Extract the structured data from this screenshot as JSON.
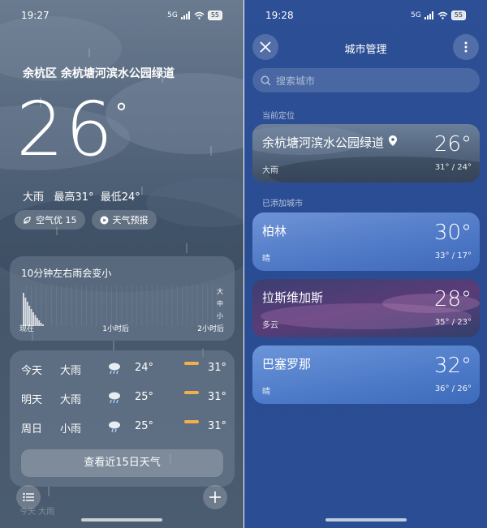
{
  "left": {
    "status": {
      "time": "19:27",
      "battery": "55",
      "network": "5G"
    },
    "location": "余杭区 余杭塘河滨水公园绿道",
    "temperature": "26",
    "degree": "°",
    "description": "大雨",
    "high": "最高31°",
    "low": "最低24°",
    "chips": [
      {
        "label": "空气优 15",
        "icon": "leaf-icon"
      },
      {
        "label": "天气预报",
        "icon": "play-icon"
      }
    ],
    "precip": {
      "title": "10分钟左右雨会变小",
      "x_labels": [
        "现在",
        "1小时后",
        "2小时后"
      ],
      "side_labels": [
        "大",
        "中",
        "小"
      ],
      "intensity": [
        0.82,
        0.7,
        0.6,
        0.5,
        0.42,
        0.34,
        0.27,
        0.2,
        0.14,
        0.08,
        0.04
      ]
    },
    "daily": [
      {
        "day": "今天",
        "cond": "大雨",
        "low": "24°",
        "high": "31°"
      },
      {
        "day": "明天",
        "cond": "大雨",
        "low": "25°",
        "high": "31°"
      },
      {
        "day": "周日",
        "cond": "小雨",
        "low": "25°",
        "high": "31°"
      }
    ],
    "fifteen_button": "查看近15日天气",
    "ghost_text": "今天 大雨"
  },
  "right": {
    "status": {
      "time": "19:28",
      "battery": "55",
      "network": "5G"
    },
    "title": "城市管理",
    "search_placeholder": "搜索城市",
    "current_section": "当前定位",
    "added_section": "已添加城市",
    "current": {
      "name": "余杭塘河滨水公园绿道",
      "cond": "大雨",
      "temp": "26°",
      "range": "31° / 24°"
    },
    "cities": [
      {
        "name": "柏林",
        "cond": "晴",
        "temp": "30°",
        "range": "33° / 17°"
      },
      {
        "name": "拉斯维加斯",
        "cond": "多云",
        "temp": "28°",
        "range": "35° / 23°"
      },
      {
        "name": "巴塞罗那",
        "cond": "晴",
        "temp": "32°",
        "range": "36° / 26°"
      }
    ]
  }
}
